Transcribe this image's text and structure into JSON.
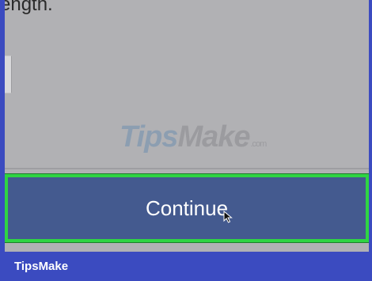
{
  "page": {
    "cropped_text": "ength.",
    "watermark": {
      "part1": "Tips",
      "part2": "Make",
      "suffix": ".com"
    },
    "continue_label": "Continue",
    "footer_brand": "TipsMake"
  },
  "colors": {
    "background": "#b1b1b4",
    "button": "#445a8f",
    "highlight": "#2fd443",
    "footer": "#3b4bc0"
  },
  "icons": [
    "cursor-arrow-icon"
  ]
}
